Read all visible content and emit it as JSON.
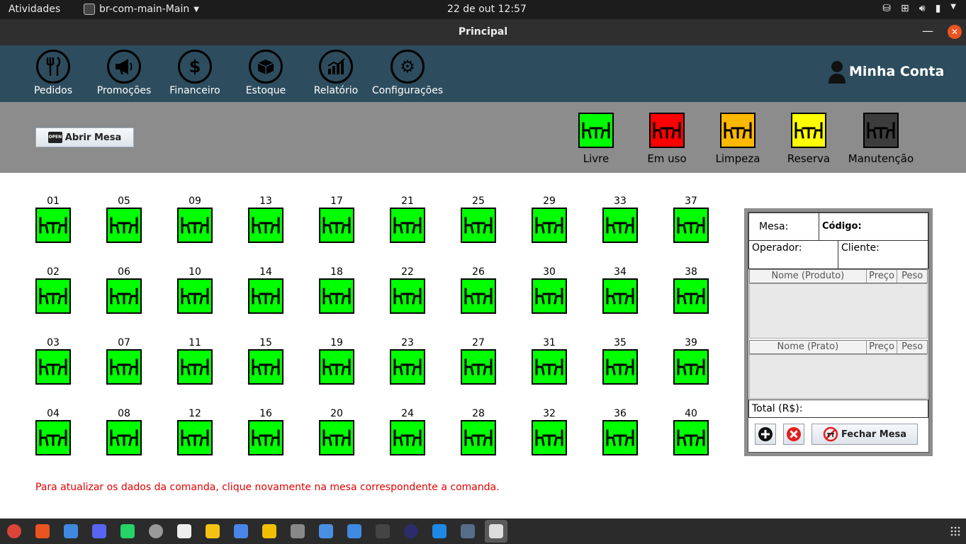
{
  "system_bar": {
    "activities": "Atividades",
    "app_name": "br-com-main-Main",
    "clock": "22 de out  12:57"
  },
  "window": {
    "title": "Principal"
  },
  "nav": {
    "items": [
      {
        "label": "Pedidos",
        "icon": "fork-knife-icon"
      },
      {
        "label": "Promoções",
        "icon": "megaphone-icon"
      },
      {
        "label": "Financeiro",
        "icon": "dollar-icon"
      },
      {
        "label": "Estoque",
        "icon": "box-icon"
      },
      {
        "label": "Relatório",
        "icon": "chart-icon"
      },
      {
        "label": "Configurações",
        "icon": "gear-icon"
      }
    ],
    "account_label": "Minha Conta"
  },
  "toolbar": {
    "open_table_label": "Abrir Mesa",
    "open_sign_text": "OPEN"
  },
  "legend": [
    {
      "label": "Livre",
      "color": "#00ff00"
    },
    {
      "label": "Em uso",
      "color": "#ff0000"
    },
    {
      "label": "Limpeza",
      "color": "#ffb800"
    },
    {
      "label": "Reserva",
      "color": "#ffff00"
    },
    {
      "label": "Manutenção",
      "color": "#3c3c3c"
    }
  ],
  "tables": [
    [
      "01",
      "02",
      "03",
      "04"
    ],
    [
      "05",
      "06",
      "07",
      "08"
    ],
    [
      "09",
      "10",
      "11",
      "12"
    ],
    [
      "13",
      "14",
      "15",
      "16"
    ],
    [
      "17",
      "18",
      "19",
      "20"
    ],
    [
      "21",
      "22",
      "23",
      "24"
    ],
    [
      "25",
      "26",
      "27",
      "28"
    ],
    [
      "29",
      "30",
      "31",
      "32"
    ],
    [
      "33",
      "34",
      "35",
      "36"
    ],
    [
      "37",
      "38",
      "39",
      "40"
    ]
  ],
  "table_status_color": "#00ff00",
  "hint": "Para atualizar os dados da comanda, clique novamente na mesa correspondente a comanda.",
  "order_panel": {
    "mesa_label": "Mesa:",
    "codigo_label": "Código:",
    "operador_label": "Operador:",
    "cliente_label": "Cliente:",
    "product_columns": [
      "Nome (Produto)",
      "Preço",
      "Peso"
    ],
    "dish_columns": [
      "Nome (Prato)",
      "Preço",
      "Peso"
    ],
    "total_label": "Total (R$):",
    "close_table_label": "Fechar Mesa"
  },
  "colors": {
    "nav_bg": "#2d4d5e",
    "band_bg": "#8c8c8c",
    "hint_color": "#e00000"
  }
}
